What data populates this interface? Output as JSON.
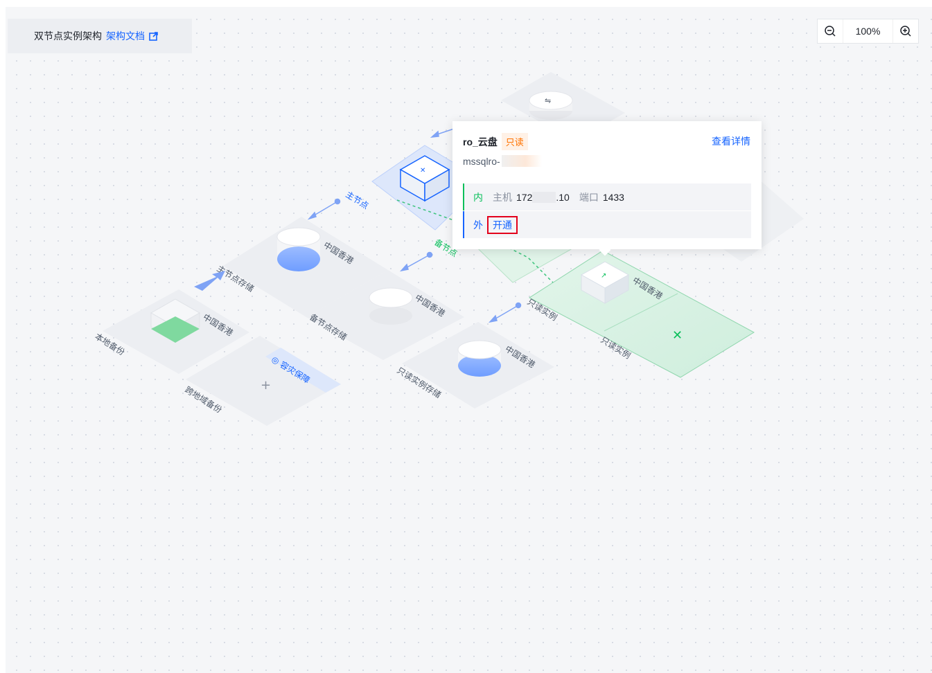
{
  "header": {
    "title": "双节点实例架构",
    "doc_link": "架构文档",
    "external_icon": "external-link-icon"
  },
  "zoom": {
    "value": "100%",
    "zoom_out_icon": "zoom-out-icon",
    "zoom_in_icon": "zoom-in-icon"
  },
  "diagram": {
    "primary_node": "主节点",
    "standby_node": "备节点",
    "primary_storage": "主节点存储",
    "standby_storage": "备节点存储",
    "readonly_instance": "只读实例",
    "readonly_instance_2": "只读实例",
    "readonly_storage": "只读实例存储",
    "local_backup": "本地备份",
    "cross_region_backup": "跨地域备份",
    "disaster_recovery": "容灾保障",
    "region_primary_storage": "中国香港",
    "region_standby_storage": "中国香港",
    "region_readonly_storage": "中国香港",
    "region_readonly_instance": "中国香港",
    "region_local_backup": "中国香港",
    "colors": {
      "primary_blue": "#1664ff",
      "readonly_green": "#0abf5b",
      "readonly_tag": "#ff7200"
    }
  },
  "popover": {
    "name": "ro_云盘",
    "tag": "只读",
    "view_details": "查看详情",
    "instance_id_prefix": "mssqlro-",
    "internal": {
      "label": "内",
      "host_label": "主机",
      "host_prefix": "172",
      "host_suffix": ".10",
      "port_label": "端口",
      "port": "1433"
    },
    "external": {
      "label": "外",
      "action": "开通"
    }
  }
}
